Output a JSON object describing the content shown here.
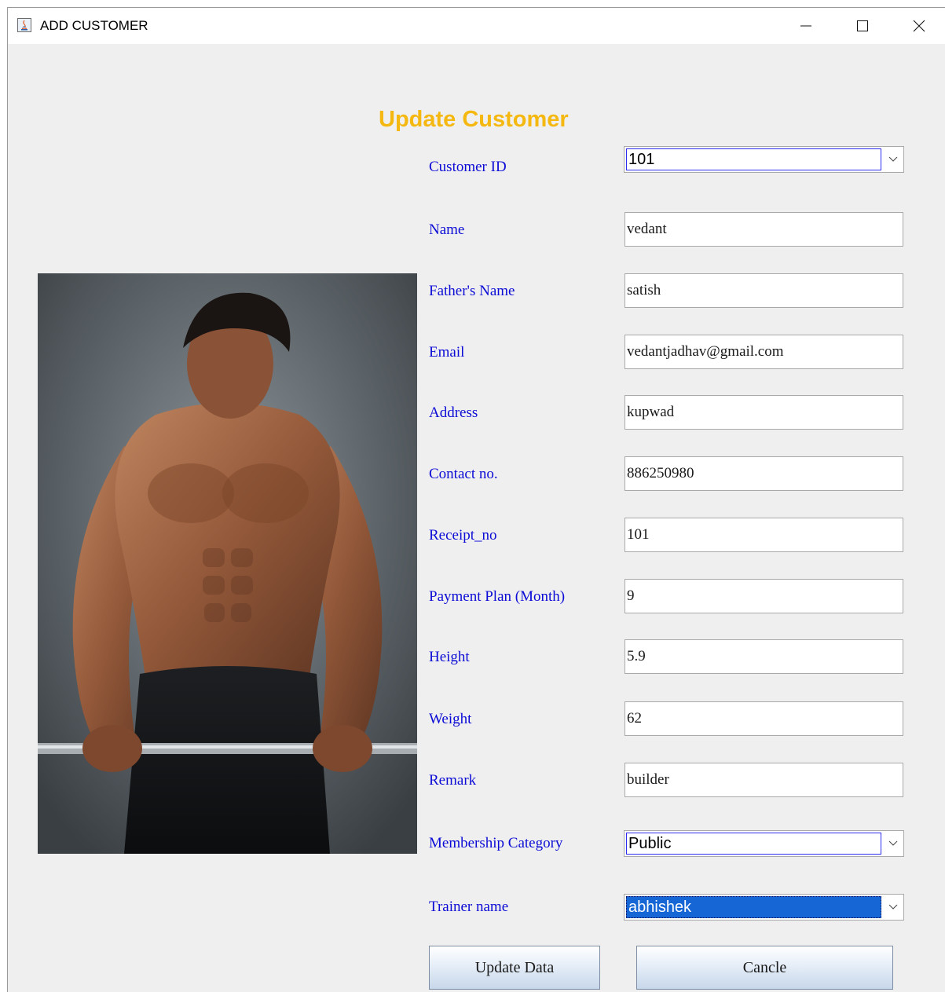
{
  "window": {
    "title": "ADD CUSTOMER"
  },
  "form": {
    "heading": "Update Customer",
    "customer_id": {
      "label": "Customer ID",
      "value": "101"
    },
    "fields": [
      {
        "label": "Name",
        "value": "vedant"
      },
      {
        "label": "Father's Name",
        "value": "satish"
      },
      {
        "label": "Email",
        "value": "vedantjadhav@gmail.com"
      },
      {
        "label": "Address",
        "value": "kupwad"
      },
      {
        "label": "Contact no.",
        "value": "886250980"
      },
      {
        "label": "Receipt_no",
        "value": "101"
      },
      {
        "label": "Payment Plan (Month)",
        "value": "9"
      },
      {
        "label": "Height",
        "value": "5.9"
      },
      {
        "label": "Weight",
        "value": "62"
      },
      {
        "label": "Remark",
        "value": "builder"
      }
    ],
    "membership_category": {
      "label": "Membership Category",
      "value": "Public"
    },
    "trainer_name": {
      "label": "Trainer name",
      "value": "abhishek"
    },
    "buttons": {
      "update": "Update Data",
      "cancel": "Cancle"
    }
  },
  "icons": {
    "app": "java-icon",
    "minimize": "minimize-icon",
    "maximize": "maximize-icon",
    "close": "close-icon",
    "dropdown": "chevron-down-icon"
  },
  "colors": {
    "heading": "#f4b810",
    "label": "#0c0cd6",
    "selection": "#1666d6",
    "background": "#efefef"
  },
  "photo": {
    "description_icon": "fitness-photo"
  }
}
